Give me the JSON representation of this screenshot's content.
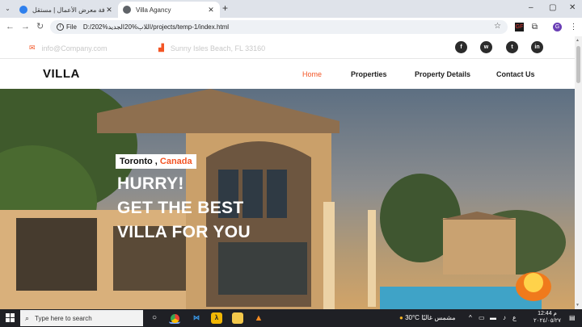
{
  "browser": {
    "tabs": [
      {
        "title": "إضافة معرض الأعمال | مستقل",
        "close": "✕",
        "favicon_color": "#2f80ed"
      },
      {
        "title": "Villa Agancy",
        "close": "✕",
        "favicon_color": "#5f6368"
      }
    ],
    "new_tab": "+",
    "window_controls": [
      "–",
      "▢",
      "✕"
    ],
    "nav": {
      "back": "←",
      "forward": "→",
      "reload": "↻"
    },
    "address": {
      "info": "i",
      "scheme": "File",
      "url": "D:/202%اللاب%20الجديد/projects/temp-1/index.html"
    },
    "star": "☆",
    "extensions": [
      "GF",
      "⧉",
      "G",
      "⋮"
    ]
  },
  "site": {
    "email": "info@Company.com",
    "address": "Sunny Isles Beach, FL 33160",
    "social": [
      "f",
      "w",
      "t",
      "in"
    ],
    "logo": "VILLA",
    "nav": [
      "Home",
      "Properties",
      "Property Details",
      "Contact Us"
    ],
    "hero": {
      "location_city": "Toronto ,",
      "location_country": "Canada",
      "line1": "HURRY!",
      "line2": "GET THE BEST",
      "line3": "VILLA FOR YOU"
    },
    "accent_color": "#f35525"
  },
  "taskbar": {
    "search_placeholder": "Type here to search",
    "weather": "30°C  مشمس غالبًا",
    "lang": "ع",
    "time": "12:44 م",
    "date": "٢٠٢٤/٠٥/٢٧"
  }
}
